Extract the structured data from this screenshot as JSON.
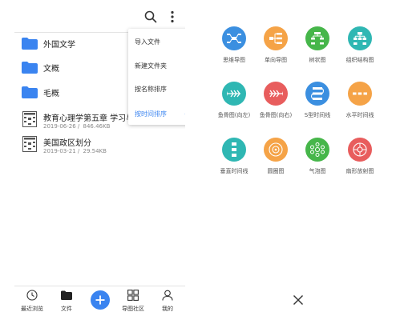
{
  "left": {
    "files": [
      {
        "name": "外国文学",
        "type": "folder"
      },
      {
        "name": "文概",
        "type": "folder"
      },
      {
        "name": "毛概",
        "type": "folder"
      },
      {
        "name": "教育心理学第五章 学习与知",
        "type": "doc",
        "date": "2019-06-26",
        "size": "846.46KB"
      },
      {
        "name": "美国政区划分",
        "type": "doc",
        "date": "2019-03-21",
        "size": "29.54KB"
      }
    ],
    "menu": {
      "import": "导入文件",
      "new_folder": "新建文件夹",
      "sort_name": "按名称排序",
      "sort_time": "按时间排序"
    },
    "nav": {
      "recent": "最近浏览",
      "files": "文件",
      "community": "导图社区",
      "mine": "我的"
    }
  },
  "right": {
    "templates": [
      {
        "label": "思维导图",
        "color": "#3b8fe0"
      },
      {
        "label": "单向导图",
        "color": "#f5a347"
      },
      {
        "label": "树状图",
        "color": "#46b64a"
      },
      {
        "label": "组织结构图",
        "color": "#2fb7b3"
      },
      {
        "label": "鱼骨图(向左)",
        "color": "#2fb7b3"
      },
      {
        "label": "鱼骨图(向右)",
        "color": "#e85d5d"
      },
      {
        "label": "S型时间线",
        "color": "#3b8fe0"
      },
      {
        "label": "水平时间线",
        "color": "#f5a347"
      },
      {
        "label": "垂直时间线",
        "color": "#2fb7b3"
      },
      {
        "label": "圆圈图",
        "color": "#f5a347"
      },
      {
        "label": "气泡图",
        "color": "#46b64a"
      },
      {
        "label": "扇形放射图",
        "color": "#e85d5d"
      }
    ]
  },
  "colors": {
    "accent": "#3a84f0",
    "folder": "#3a84f0"
  }
}
